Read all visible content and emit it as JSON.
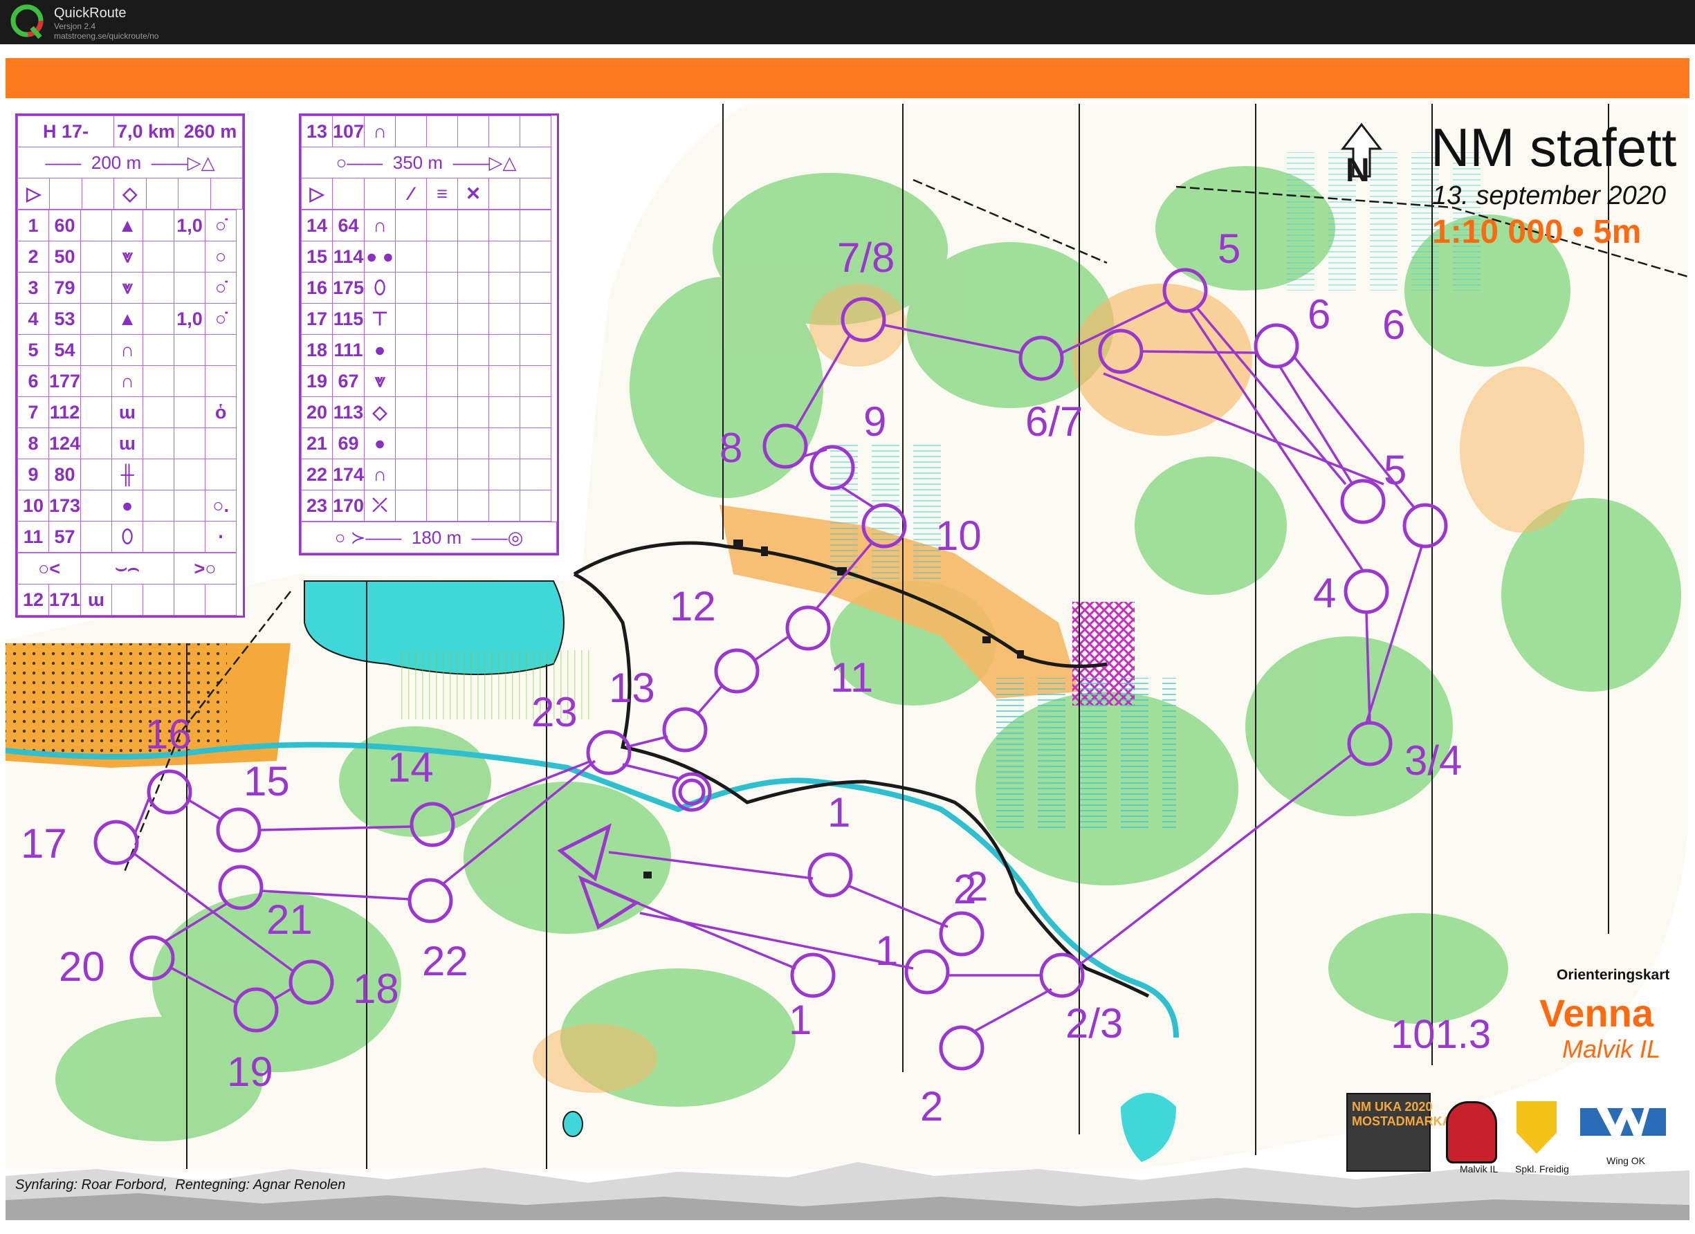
{
  "app": {
    "name": "QuickRoute",
    "version": "Versjon 2.4",
    "url": "matstroeng.se/quickroute/no"
  },
  "map": {
    "title": "NM stafett",
    "date": "13. september 2020",
    "scale": "1:10 000 • 5m",
    "type_label": "Orienteringskart",
    "name": "Venna",
    "club": "Malvik IL",
    "frequency": "101.3",
    "credits_label1": "Synfaring:",
    "credits_name1": "Roar Forbord,",
    "credits_label2": "Rentegning:",
    "credits_name2": "Agnar Renolen",
    "logos": [
      "NM UKA 2020 MOSTADMARKA",
      "Malvik IL",
      "Spkl. Freidig",
      "Wing OK"
    ],
    "control_labels": [
      "1",
      "1",
      "1",
      "2",
      "2",
      "2",
      "2/3",
      "3/4",
      "4",
      "5",
      "5",
      "6",
      "6",
      "6/7",
      "7/8",
      "8",
      "9",
      "10",
      "11",
      "12",
      "13",
      "14",
      "15",
      "16",
      "17",
      "18",
      "19",
      "20",
      "21",
      "22",
      "23"
    ]
  },
  "colors": {
    "course": "#9b36cf",
    "orange": "#ff7a1f",
    "water": "#3fd7d7",
    "forest": "#79d479"
  },
  "description": {
    "class": "H 17-",
    "length": "7,0 km",
    "climb": "260 m",
    "start_marking": "200 m",
    "marking_350": "350 m",
    "finish_marking": "180 m",
    "left_rows": [
      {
        "n": "1",
        "code": "60",
        "feat": "▲",
        "dim": "1,0",
        "loc": "○̇"
      },
      {
        "n": "2",
        "code": "50",
        "feat": "⩔",
        "dim": "",
        "loc": "○"
      },
      {
        "n": "3",
        "code": "79",
        "feat": "⩔",
        "dim": "",
        "loc": "○̇"
      },
      {
        "n": "4",
        "code": "53",
        "feat": "▲",
        "dim": "1,0",
        "loc": "○̇"
      },
      {
        "n": "5",
        "code": "54",
        "feat": "∩",
        "dim": "",
        "loc": ""
      },
      {
        "n": "6",
        "code": "177",
        "feat": "∩",
        "dim": "",
        "loc": ""
      },
      {
        "n": "7",
        "code": "112",
        "feat": "ɯ",
        "dim": "",
        "loc": "ὁ"
      },
      {
        "n": "8",
        "code": "124",
        "feat": "ɯ",
        "dim": "",
        "loc": ""
      },
      {
        "n": "9",
        "code": "80",
        "feat": "╫",
        "dim": "",
        "loc": ""
      },
      {
        "n": "10",
        "code": "173",
        "feat": "●",
        "dim": "",
        "loc": "○."
      },
      {
        "n": "11",
        "code": "57",
        "feat": "⬯",
        "dim": "",
        "loc": "⋅"
      },
      {
        "n": "12",
        "code": "171",
        "feat": "ɯ",
        "dim": "",
        "loc": ""
      }
    ],
    "right_rows": [
      {
        "n": "13",
        "code": "107",
        "feat": "∩"
      },
      {
        "n": "14",
        "code": "64",
        "feat": "∩"
      },
      {
        "n": "15",
        "code": "114",
        "feat": "● ●"
      },
      {
        "n": "16",
        "code": "175",
        "feat": "⬯"
      },
      {
        "n": "17",
        "code": "115",
        "feat": "⊤"
      },
      {
        "n": "18",
        "code": "111",
        "feat": "●"
      },
      {
        "n": "19",
        "code": "67",
        "feat": "⩔"
      },
      {
        "n": "20",
        "code": "113",
        "feat": "◇"
      },
      {
        "n": "21",
        "code": "69",
        "feat": "●"
      },
      {
        "n": "22",
        "code": "174",
        "feat": "∩"
      },
      {
        "n": "23",
        "code": "170",
        "feat": "⤫"
      }
    ]
  }
}
